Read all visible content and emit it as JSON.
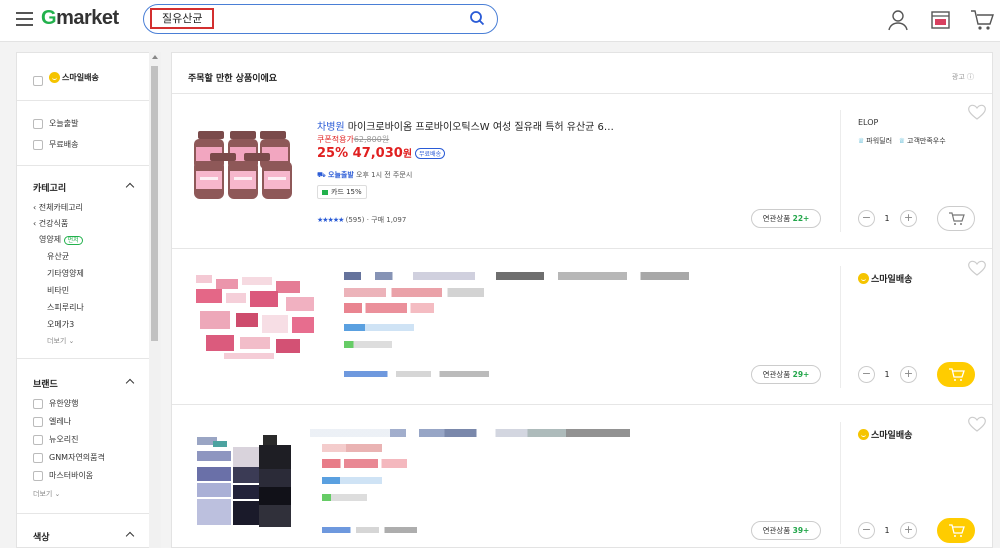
{
  "header": {
    "logo_g": "G",
    "logo_rest": "market",
    "search_value": "질유산균",
    "icons": [
      "menu-icon",
      "search-icon",
      "user-icon",
      "recent-items-icon",
      "cart-icon"
    ]
  },
  "sidebar": {
    "smile_delivery": "스마일배송",
    "filters": [
      "오늘출발",
      "무료배송"
    ],
    "category": {
      "title": "카테고리",
      "items": [
        "전체카테고리",
        "건강식품"
      ],
      "current": "영양제",
      "tag": "먼저",
      "subs": [
        "유산균",
        "기타영양제",
        "비타민",
        "스피루리나",
        "오메가3"
      ],
      "more": "더보기"
    },
    "brand": {
      "title": "브랜드",
      "items": [
        "유한양행",
        "엘레나",
        "뉴오리진",
        "GNM자연의품격",
        "마스터바이옴"
      ],
      "more": "더보기"
    },
    "color": {
      "title": "색상"
    }
  },
  "main": {
    "section_title": "주목할 만한 상품이에요",
    "ad_label": "광고",
    "products": [
      {
        "brand": "차병원",
        "title": "마이크로바이옴 프로바이오틱스W 여성 질유래 특허 유산균 6…",
        "coupon_label": "쿠폰적용가",
        "original_price": "62,800원",
        "discount": "25%",
        "price": "47,030",
        "price_unit": "원",
        "free_shipping": "무료배송",
        "delivery_badge": "오늘출발",
        "delivery_text": "오후 1시 전 주문시",
        "card": "카드 15%",
        "stars": "★★★★★",
        "reviews": "(595)",
        "purchases": "· 구매 1,097",
        "related_label": "연관상품",
        "related_count": "22+",
        "seller": "ELOP",
        "badge1": "파워딜러",
        "badge2": "고객만족우수",
        "qty": "1"
      },
      {
        "related_label": "연관상품",
        "related_count": "29+",
        "smile": "스마일배송",
        "qty": "1"
      },
      {
        "related_label": "연관상품",
        "related_count": "39+",
        "smile": "스마일배송",
        "qty": "1"
      }
    ]
  },
  "colors": {
    "accent_green": "#22b14c",
    "price_red": "#e02020",
    "link_blue": "#2a5bd6",
    "cart_yellow": "#ffcc00"
  }
}
